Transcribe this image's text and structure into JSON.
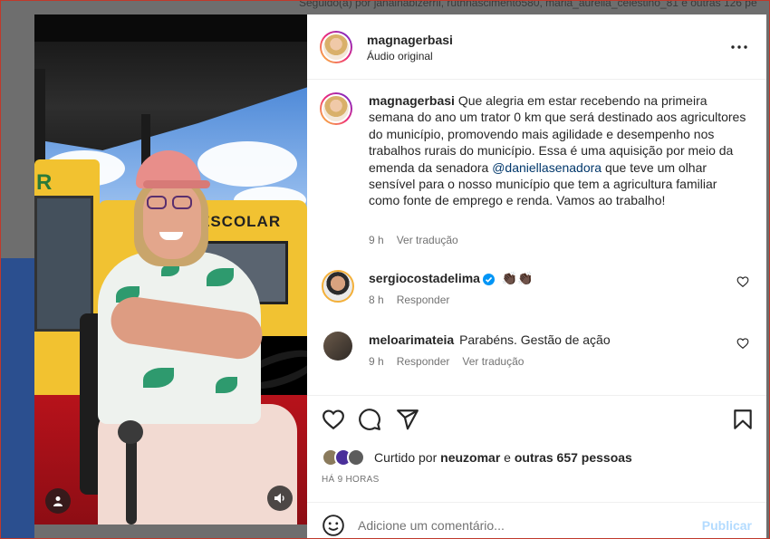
{
  "background": {
    "followers_text": "Seguido(a) por janainabizerril, ruthnascimento580, maria_aurelia_celestino_81 e outras 126 pe"
  },
  "media": {
    "bus_sign_text": "ESCOLAR",
    "bus_left_letter": "R",
    "user_tag_icon": "person-icon",
    "sound_icon": "speaker-icon"
  },
  "post": {
    "author": "magnagerbasi",
    "audio_label": "Áudio original",
    "more_icon": "more-horizontal-icon",
    "caption": {
      "before_mention": "Que alegria em estar recebendo na primeira semana do ano um trator 0 km que será destinado aos agricultores do município, promovendo mais agilidade e desempenho nos trabalhos rurais do município. Essa é uma aquisição por meio da emenda da senadora ",
      "mention": "@daniellasenadora",
      "after_mention": " que teve um olhar sensível para o nosso município que tem a agricultura familiar como fonte de emprego e renda. Vamos ao trabalho!",
      "time": "9 h",
      "translate": "Ver tradução"
    },
    "comments": [
      {
        "user": "sergiocostadelima",
        "text": "👏🏿👏🏿",
        "time": "8 h",
        "reply": "Responder",
        "verified": true
      },
      {
        "user": "meloarimateia",
        "text": "Parabéns. Gestão de ação",
        "time": "9 h",
        "reply": "Responder",
        "translate": "Ver tradução"
      }
    ],
    "likes": {
      "prefix": "Curtido por",
      "user": "neuzomar",
      "conjunction": "e",
      "others": "outras 657 pessoas"
    },
    "time_ago": "HÁ 9 HORAS",
    "comment_box": {
      "placeholder": "Adicione um comentário...",
      "publish": "Publicar"
    }
  },
  "colors": {
    "link": "#00376b",
    "muted": "#737373",
    "publish_disabled": "#b3dbff",
    "verified": "#0095f6"
  }
}
